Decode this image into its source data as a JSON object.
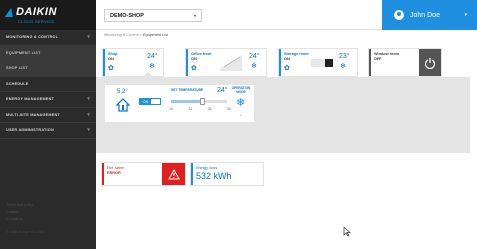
{
  "brand": {
    "name": "DAIKIN",
    "subtitle": "CLOUD SERVICE"
  },
  "sidebar": {
    "items": [
      {
        "label": "MONITORING & CONTROL",
        "chevron": "▾",
        "sub": false
      },
      {
        "label": "EQUIPMENT LIST",
        "chevron": "",
        "sub": true
      },
      {
        "label": "SHOP LIST",
        "chevron": "",
        "sub": true
      },
      {
        "label": "SCHEDULE",
        "chevron": "",
        "sub": false
      },
      {
        "label": "ENERGY MANAGEMENT",
        "chevron": "▾",
        "sub": false
      },
      {
        "label": "MULTI-SITE MANAGEMENT",
        "chevron": "▾",
        "sub": false
      },
      {
        "label": "USER ADMINISTRATION",
        "chevron": "▾",
        "sub": false
      }
    ],
    "footer": {
      "line1": "Terms and policy",
      "line2": "Cookies",
      "line3": "Contact us",
      "copyright": "© Daikin Europe N.V. 2014"
    }
  },
  "topbar": {
    "shop": "DEMO-SHOP",
    "shop_caret": "▾",
    "user_name": "John Doe",
    "user_caret": "▾"
  },
  "breadcrumb": {
    "parent": "Monitoring & Control",
    "sep": ">",
    "current": "Equipment List"
  },
  "units": [
    {
      "name": "Shop",
      "state": "ON",
      "temp": "24°",
      "mode": "❄",
      "fan": "✿",
      "color": "#1f8fe0"
    },
    {
      "name": "Office front",
      "state": "ON",
      "temp": "24°",
      "mode": "❄",
      "fan": "✿",
      "color": "#1f8fe0"
    },
    {
      "name": "Storage room",
      "state": "ON",
      "temp": "23°",
      "mode": "❄",
      "fan": "✿",
      "color": "#1f8fe0"
    },
    {
      "name": "Window room",
      "state": "OFF",
      "temp": "",
      "mode": "",
      "fan": "",
      "color": "#555555"
    }
  ],
  "detail": {
    "room_temp": "5.2°",
    "toggle": "ON",
    "set_label": "SET TEMPERATURE",
    "set_value": "24°",
    "scale": [
      "16",
      "21",
      "26",
      "30"
    ],
    "setpoint_fraction": 0.57,
    "op_label": "OPERATION MODE"
  },
  "alarms": [
    {
      "title": "Fire alarm",
      "value": "ERROR",
      "color": "#e02020"
    },
    {
      "title": "Energy cons.",
      "value": "532 kWh",
      "color": "#1f8fe0"
    }
  ],
  "colors": {
    "accent": "#1f8fe0",
    "sidebar": "#2b2b2b",
    "panel": "#e4e4e4",
    "alarm": "#e02020"
  }
}
